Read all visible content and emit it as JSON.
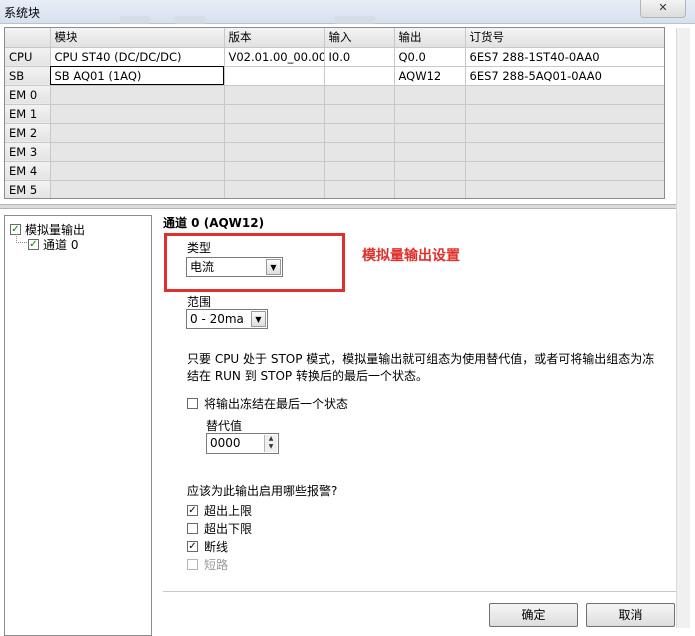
{
  "window": {
    "title": "系统块",
    "close_label": "✕"
  },
  "grid": {
    "columns": [
      "",
      "模块",
      "版本",
      "输入",
      "输出",
      "订货号"
    ],
    "rows": [
      {
        "slot": "CPU",
        "module": "CPU ST40 (DC/DC/DC)",
        "version": "V02.01.00_00.00...",
        "input": "I0.0",
        "output": "Q0.0",
        "order": "6ES7 288-1ST40-0AA0"
      },
      {
        "slot": "SB",
        "module": "SB AQ01 (1AQ)",
        "version": "",
        "input": "",
        "output": "AQW12",
        "order": "6ES7 288-5AQ01-0AA0"
      },
      {
        "slot": "EM 0",
        "module": "",
        "version": "",
        "input": "",
        "output": "",
        "order": ""
      },
      {
        "slot": "EM 1",
        "module": "",
        "version": "",
        "input": "",
        "output": "",
        "order": ""
      },
      {
        "slot": "EM 2",
        "module": "",
        "version": "",
        "input": "",
        "output": "",
        "order": ""
      },
      {
        "slot": "EM 3",
        "module": "",
        "version": "",
        "input": "",
        "output": "",
        "order": ""
      },
      {
        "slot": "EM 4",
        "module": "",
        "version": "",
        "input": "",
        "output": "",
        "order": ""
      },
      {
        "slot": "EM 5",
        "module": "",
        "version": "",
        "input": "",
        "output": "",
        "order": ""
      }
    ]
  },
  "tree": {
    "root": {
      "label": "模拟量输出",
      "checked": true
    },
    "child": {
      "label": "通道 0",
      "checked": true
    }
  },
  "panel": {
    "channel_title": "通道 0 (AQW12)",
    "type_label": "类型",
    "type_value": "电流",
    "range_label": "范围",
    "range_value": "0 - 20ma",
    "note": "只要 CPU 处于 STOP 模式，模拟量输出就可组态为使用替代值，或者可将输出组态为冻结在 RUN 到 STOP 转换后的最后一个状态。",
    "freeze_label": "将输出冻结在最后一个状态",
    "freeze_checked": false,
    "substitute_label": "替代值",
    "substitute_value": "0000",
    "alarms_heading": "应该为此输出启用哪些报警?",
    "alarms": [
      {
        "label": "超出上限",
        "checked": true,
        "enabled": true
      },
      {
        "label": "超出下限",
        "checked": false,
        "enabled": true
      },
      {
        "label": "断线",
        "checked": true,
        "enabled": true
      },
      {
        "label": "短路",
        "checked": false,
        "enabled": false
      }
    ]
  },
  "buttons": {
    "ok": "确定",
    "cancel": "取消"
  },
  "annotation": {
    "text": "模拟量输出设置",
    "color": "#e0302b"
  }
}
